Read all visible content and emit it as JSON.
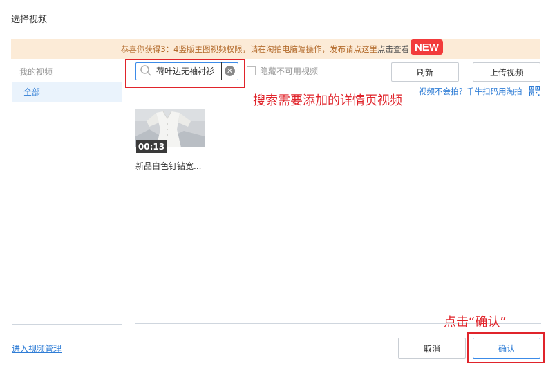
{
  "dialog": {
    "title": "选择视频"
  },
  "notice": {
    "text": "恭喜你获得3：4竖版主图视频权限，请在淘拍电脑端操作，发布请点这里",
    "link_text": "点击查看",
    "badge": "NEW"
  },
  "sidebar": {
    "header": "我的视频",
    "items": [
      {
        "label": "全部",
        "selected": true
      }
    ]
  },
  "search": {
    "value": "荷叶边无袖衬衫",
    "placeholder": ""
  },
  "filter": {
    "hide_unavailable_label": "隐藏不可用视频",
    "checked": false
  },
  "toolbar": {
    "refresh_label": "刷新",
    "upload_label": "上传视频"
  },
  "help": {
    "text": "视频不会拍？千牛扫码用淘拍"
  },
  "annotations": {
    "search_note": "搜索需要添加的详情页视频",
    "confirm_note": "点击“确认”"
  },
  "videos": [
    {
      "title": "新品白色钉钻宽...",
      "duration": "00:13"
    }
  ],
  "footer": {
    "manage_link": "进入视频管理",
    "cancel_label": "取消",
    "confirm_label": "确认"
  },
  "colors": {
    "accent": "#2f7dd6",
    "annotation_red": "#e0242b",
    "notice_bg": "#fcebd7",
    "badge_red": "#f23b3b"
  }
}
